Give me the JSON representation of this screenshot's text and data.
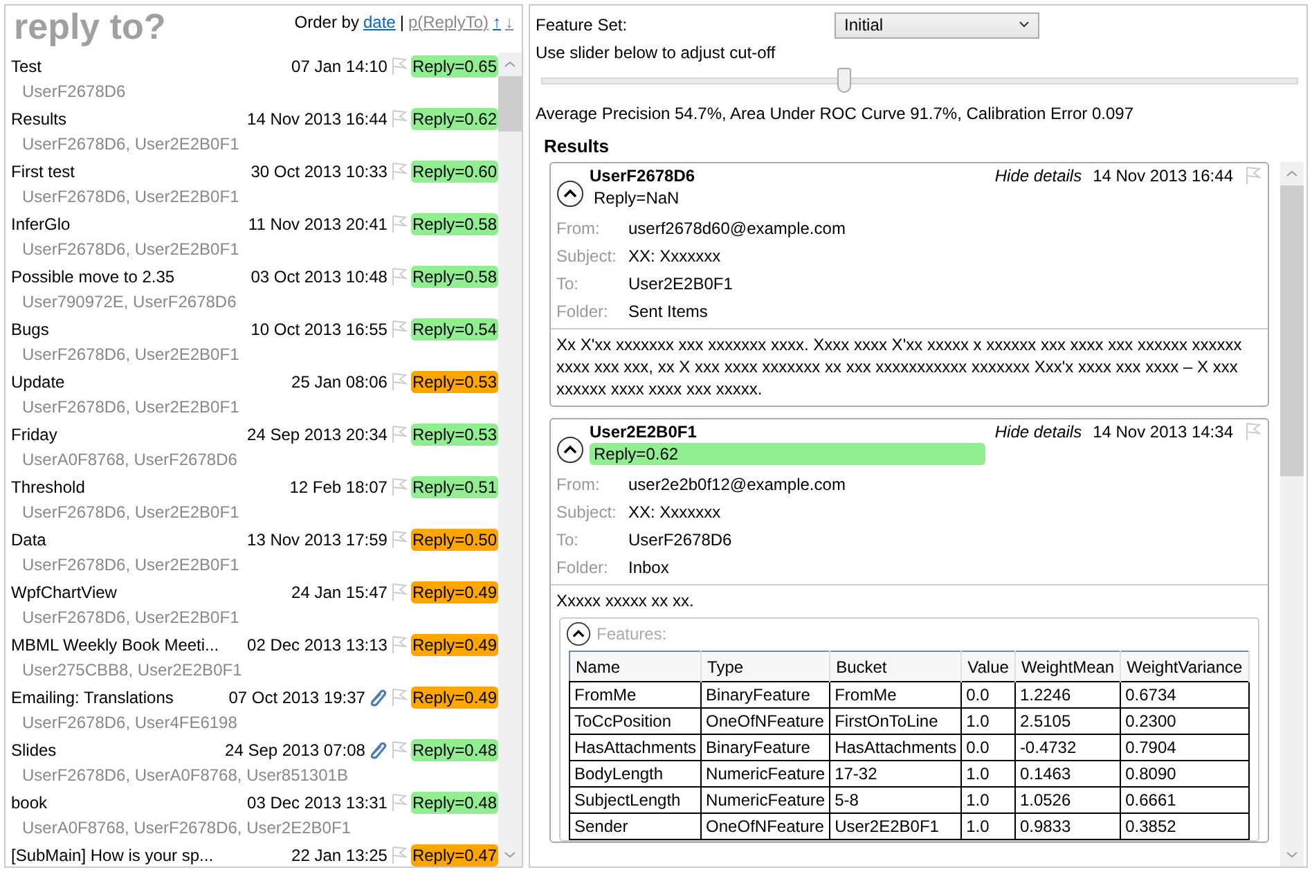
{
  "left": {
    "title": "reply to?",
    "order_label": "Order by",
    "separator": "|",
    "sort_options": [
      {
        "label": "date",
        "selected": true
      },
      {
        "label": "p(ReplyTo)",
        "selected": false
      }
    ],
    "sort_up": "↑",
    "sort_down": "↓",
    "messages": [
      {
        "subject": "Test",
        "date": "07 Jan 14:10",
        "attachment": false,
        "reply": "Reply=0.65",
        "color": "#90ee90",
        "recipients": "UserF2678D6"
      },
      {
        "subject": "Results",
        "date": "14 Nov 2013 16:44",
        "attachment": false,
        "reply": "Reply=0.62",
        "color": "#90ee90",
        "recipients": "UserF2678D6, User2E2B0F1"
      },
      {
        "subject": "First test",
        "date": "30 Oct 2013 10:33",
        "attachment": false,
        "reply": "Reply=0.60",
        "color": "#90ee90",
        "recipients": "UserF2678D6, User2E2B0F1"
      },
      {
        "subject": "InferGlo",
        "date": "11 Nov 2013 20:41",
        "attachment": false,
        "reply": "Reply=0.58",
        "color": "#90ee90",
        "recipients": "UserF2678D6, User2E2B0F1"
      },
      {
        "subject": "Possible move to 2.35",
        "date": "03 Oct 2013 10:48",
        "attachment": false,
        "reply": "Reply=0.58",
        "color": "#90ee90",
        "recipients": "User790972E, UserF2678D6"
      },
      {
        "subject": "Bugs",
        "date": "10 Oct 2013 16:55",
        "attachment": false,
        "reply": "Reply=0.54",
        "color": "#90ee90",
        "recipients": "UserF2678D6, User2E2B0F1"
      },
      {
        "subject": "Update",
        "date": "25 Jan 08:06",
        "attachment": false,
        "reply": "Reply=0.53",
        "color": "#ffa500",
        "recipients": "UserF2678D6, User2E2B0F1"
      },
      {
        "subject": "Friday",
        "date": "24 Sep 2013 20:34",
        "attachment": false,
        "reply": "Reply=0.53",
        "color": "#90ee90",
        "recipients": "UserA0F8768, UserF2678D6"
      },
      {
        "subject": "Threshold",
        "date": "12 Feb 18:07",
        "attachment": false,
        "reply": "Reply=0.51",
        "color": "#90ee90",
        "recipients": "UserF2678D6, User2E2B0F1"
      },
      {
        "subject": "Data",
        "date": "13 Nov 2013 17:59",
        "attachment": false,
        "reply": "Reply=0.50",
        "color": "#ffa500",
        "recipients": "UserF2678D6, User2E2B0F1"
      },
      {
        "subject": "WpfChartView",
        "date": "24 Jan 15:47",
        "attachment": false,
        "reply": "Reply=0.49",
        "color": "#ffa500",
        "recipients": "UserF2678D6, User2E2B0F1"
      },
      {
        "subject": "MBML Weekly Book Meeti...",
        "date": "02 Dec 2013 13:13",
        "attachment": false,
        "reply": "Reply=0.49",
        "color": "#ffa500",
        "recipients": "User275CBB8, User2E2B0F1"
      },
      {
        "subject": "Emailing: Translations",
        "date": "07 Oct 2013 19:37",
        "attachment": true,
        "reply": "Reply=0.49",
        "color": "#ffa500",
        "recipients": "UserF2678D6, User4FE6198"
      },
      {
        "subject": "Slides",
        "date": "24 Sep 2013 07:08",
        "attachment": true,
        "reply": "Reply=0.48",
        "color": "#90ee90",
        "recipients": "UserF2678D6, UserA0F8768, User851301B"
      },
      {
        "subject": "book",
        "date": "03 Dec 2013 13:31",
        "attachment": false,
        "reply": "Reply=0.48",
        "color": "#90ee90",
        "recipients": "UserA0F8768, UserF2678D6, User2E2B0F1"
      },
      {
        "subject": "[SubMain] How is your sp...",
        "date": "22 Jan 13:25",
        "attachment": false,
        "reply": "Reply=0.47",
        "color": "#ffa500"
      }
    ]
  },
  "right": {
    "feature_set_label": "Feature Set:",
    "feature_set": "Initial",
    "slider_label": "Use slider below to adjust cut-off",
    "slider": {
      "level": 0.4
    },
    "metrics": "Average Precision 54.7%, Area Under ROC Curve 91.7%, Calibration Error 0.097",
    "results_title": "Results",
    "results": [
      {
        "sender": "UserF2678D6",
        "reply": "Reply=NaN",
        "hide_details": "Hide details",
        "date": "14 Nov 2013 16:44",
        "fields": [
          {
            "label": "From:",
            "value": "userf2678d60@example.com"
          },
          {
            "label": "Subject:",
            "value": "XX: Xxxxxxx"
          },
          {
            "label": "To:",
            "value": "User2E2B0F1"
          },
          {
            "label": "Folder:",
            "value": "Sent Items"
          }
        ],
        "body": "Xx X'xx xxxxxxx xxx xxxxxxx xxxx.  Xxxx xxxx X'xx xxxxx x xxxxxx xxx xxxx xxx xxxxxx xxxxxx xxxx xxx xxx, xx X xxx xxxx xxxxxxx xx xxx xxxxxxxxxxx xxxxxxx Xxx'x xxxx xxx xxxx – X xxx xxxxxx xxxx xxxx xxx xxxxx."
      },
      {
        "sender": "User2E2B0F1",
        "reply": "Reply=0.62",
        "color": "#90ee90",
        "hide_details": "Hide details",
        "date": "14 Nov 2013 14:34",
        "fields": [
          {
            "label": "From:",
            "value": "user2e2b0f12@example.com"
          },
          {
            "label": "Subject:",
            "value": "XX: Xxxxxxx"
          },
          {
            "label": "To:",
            "value": "UserF2678D6"
          },
          {
            "label": "Folder:",
            "value": "Inbox"
          }
        ],
        "body": "Xxxxx xxxxx xx xx.",
        "features": {
          "label": "Features:",
          "columns": [
            "Name",
            "Type",
            "Bucket",
            "Value",
            "WeightMean",
            "WeightVariance"
          ],
          "rows": [
            [
              "FromMe",
              "BinaryFeature",
              "FromMe",
              "0.0",
              "1.2246",
              "0.6734"
            ],
            [
              "ToCcPosition",
              "OneOfNFeature",
              "FirstOnToLine",
              "1.0",
              "2.5105",
              "0.2300"
            ],
            [
              "HasAttachments",
              "BinaryFeature",
              "HasAttachments",
              "0.0",
              "-0.4732",
              "0.7904"
            ],
            [
              "BodyLength",
              "NumericFeature",
              "17-32",
              "1.0",
              "0.1463",
              "0.8090"
            ],
            [
              "SubjectLength",
              "NumericFeature",
              "5-8",
              "1.0",
              "1.0526",
              "0.6661"
            ],
            [
              "Sender",
              "OneOfNFeature",
              "User2E2B0F1",
              "1.0",
              "0.9833",
              "0.3852"
            ]
          ]
        }
      }
    ]
  }
}
